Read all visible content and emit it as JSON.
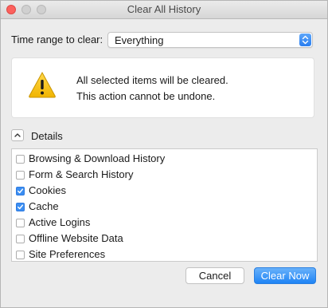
{
  "window": {
    "title": "Clear All History",
    "accent_color": "#3b8ef2",
    "close_color": "#fc615d"
  },
  "time_range": {
    "label": "Time range to clear:",
    "selected": "Everything",
    "stepper_icon": "up-down-chevron-icon"
  },
  "warning": {
    "icon": "warning-triangle-icon",
    "line1": "All selected items will be cleared.",
    "line2": "This action cannot be undone."
  },
  "details": {
    "toggle_icon": "chevron-up-icon",
    "label": "Details",
    "items": [
      {
        "label": "Browsing & Download History",
        "checked": false
      },
      {
        "label": "Form & Search History",
        "checked": false
      },
      {
        "label": "Cookies",
        "checked": true
      },
      {
        "label": "Cache",
        "checked": true
      },
      {
        "label": "Active Logins",
        "checked": false
      },
      {
        "label": "Offline Website Data",
        "checked": false
      },
      {
        "label": "Site Preferences",
        "checked": false
      }
    ]
  },
  "buttons": {
    "cancel": "Cancel",
    "clear_now": "Clear Now"
  }
}
